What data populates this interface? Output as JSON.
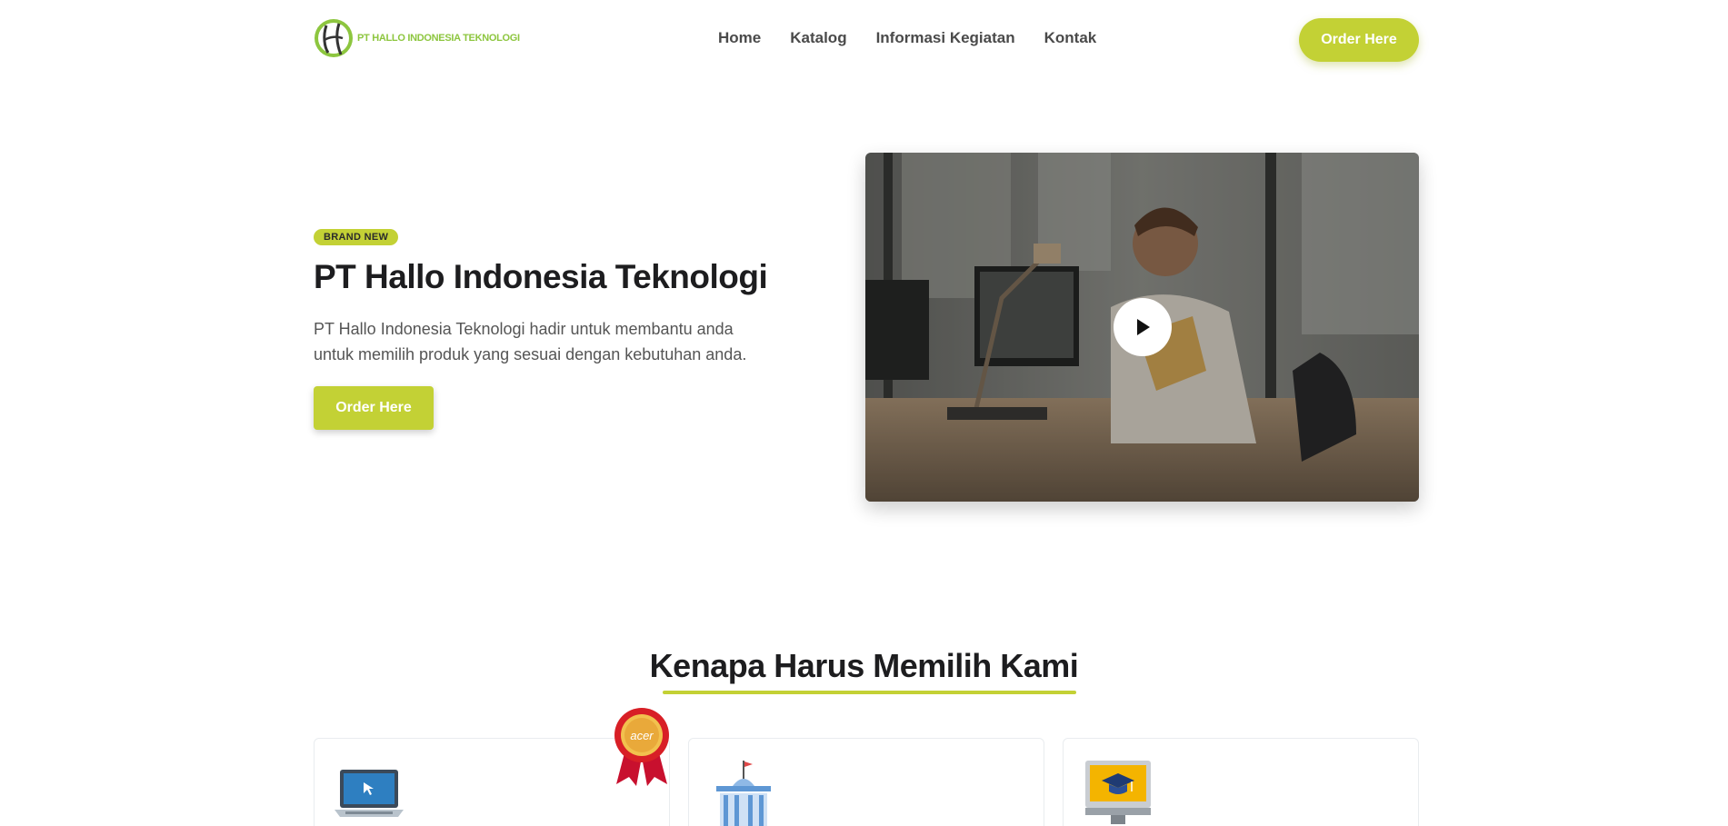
{
  "header": {
    "logo_text": "PT HALLO INDONESIA TEKNOLOGI",
    "nav": [
      "Home",
      "Katalog",
      "Informasi Kegiatan",
      "Kontak"
    ],
    "cta_label": "Order Here"
  },
  "hero": {
    "badge": "BRAND NEW",
    "title": "PT Hallo Indonesia Teknologi",
    "description": "PT Hallo Indonesia Teknologi hadir untuk membantu anda untuk memilih produk yang sesuai dengan kebutuhan anda.",
    "cta_label": "Order Here",
    "video_icon": "play-icon"
  },
  "why": {
    "title": "Kenapa Harus Memilih Kami",
    "award_text": "acer",
    "cards": [
      {
        "icon": "laptop-icon"
      },
      {
        "icon": "government-building-icon"
      },
      {
        "icon": "graduation-monitor-icon"
      }
    ]
  },
  "colors": {
    "accent": "#c3d135",
    "logo_green": "#8dc63f",
    "text_dark": "#1d1d1f"
  }
}
